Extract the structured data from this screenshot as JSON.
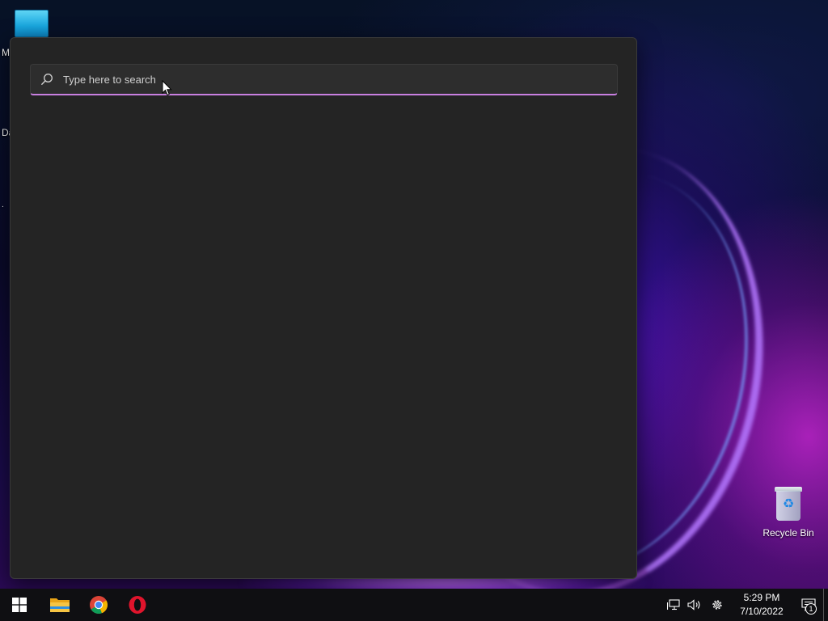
{
  "desktop": {
    "left_clipped_labels": [
      "M",
      "Da",
      "."
    ],
    "recycle_bin_label": "Recycle Bin"
  },
  "search": {
    "placeholder": "Type here to search",
    "value": "",
    "accent_color": "#c87fe0"
  },
  "taskbar": {
    "apps": [
      {
        "name": "start",
        "icon": "windows-logo-icon"
      },
      {
        "name": "file-explorer",
        "icon": "folder-icon"
      },
      {
        "name": "chrome",
        "icon": "chrome-icon"
      },
      {
        "name": "opera",
        "icon": "opera-icon"
      }
    ],
    "tray": {
      "time": "5:29 PM",
      "date": "7/10/2022",
      "notification_count": "1"
    }
  }
}
